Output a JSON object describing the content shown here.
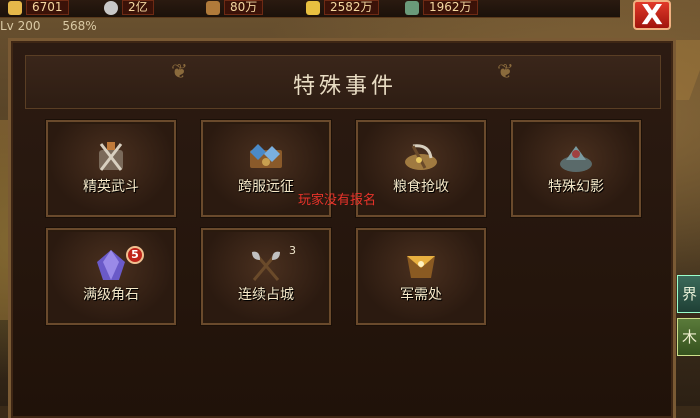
{
  "resources": [
    {
      "name": "gold",
      "value": "6701",
      "color": "#e6b84a"
    },
    {
      "name": "silver",
      "value": "2亿",
      "color": "#c8c8c8"
    },
    {
      "name": "wood",
      "value": "80万",
      "color": "#b07a3a"
    },
    {
      "name": "food",
      "value": "2582万",
      "color": "#e8c040"
    },
    {
      "name": "ore",
      "value": "1962万",
      "color": "#6a9a7a"
    }
  ],
  "status": {
    "level": "Lv 200",
    "percent": "568%"
  },
  "close_label": "X",
  "panel": {
    "title": "特殊事件",
    "events": [
      {
        "label": "精英武斗",
        "icon": "crossed-swords-icon",
        "color": "#c07a3a"
      },
      {
        "label": "跨服远征",
        "icon": "map-gems-icon",
        "color": "#4a8ac8"
      },
      {
        "label": "粮食抢收",
        "icon": "sickle-grain-icon",
        "color": "#c8a050"
      },
      {
        "label": "特殊幻影",
        "icon": "phantom-armor-icon",
        "color": "#5a8a8a"
      },
      {
        "label": "满级角石",
        "icon": "crystal-stone-icon",
        "color": "#6a5ac8",
        "badge": "5"
      },
      {
        "label": "连续占城",
        "icon": "battle-axes-icon",
        "color": "#b0b0b0",
        "count": "3"
      },
      {
        "label": "军需处",
        "icon": "supply-scroll-icon",
        "color": "#d8a040"
      }
    ],
    "notice": "玩家没有报名"
  },
  "side_buttons": [
    "界",
    "木"
  ]
}
